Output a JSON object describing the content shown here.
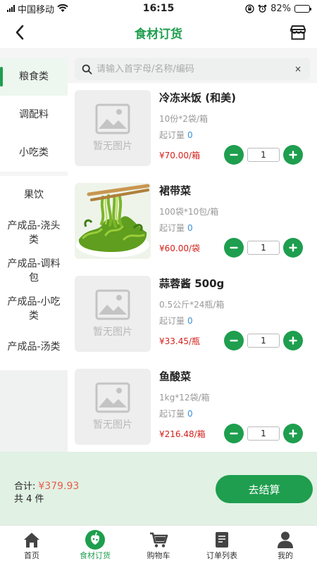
{
  "status_bar": {
    "carrier": "中国移动",
    "time": "16:15",
    "battery": "82%",
    "battery_level": 0.82
  },
  "header": {
    "title": "食材订货"
  },
  "search": {
    "placeholder": "请输入首字母/名称/编码",
    "clear": "×"
  },
  "categories": [
    {
      "label": "粮食类",
      "active": true
    },
    {
      "label": "调配料"
    },
    {
      "label": "小吃类"
    },
    {
      "label": "果饮"
    },
    {
      "label": "产成品-浇头类"
    },
    {
      "label": "产成品-调料包"
    },
    {
      "label": "产成品-小吃类"
    },
    {
      "label": "产成品-汤类"
    }
  ],
  "products": [
    {
      "name": "冷冻米饭 (和美)",
      "spec": "10份*2袋/箱",
      "moq_label": "起订量",
      "moq": "0",
      "price": "¥70.00/箱",
      "qty": "1",
      "image": "no-image",
      "no_image_text": "暂无图片"
    },
    {
      "name": "裙带菜",
      "spec": "100袋*10包/箱",
      "moq_label": "起订量",
      "moq": "0",
      "price": "¥60.00/袋",
      "qty": "1",
      "image": "seaweed-photo"
    },
    {
      "name": "蒜蓉酱 500g",
      "spec": "0.5公斤*24瓶/箱",
      "moq_label": "起订量",
      "moq": "0",
      "price": "¥33.45/瓶",
      "qty": "1",
      "image": "no-image",
      "no_image_text": "暂无图片"
    },
    {
      "name": "鱼酸菜",
      "spec": "1kg*12袋/箱",
      "moq_label": "起订量",
      "moq": "0",
      "price": "¥216.48/箱",
      "qty": "1",
      "image": "no-image",
      "no_image_text": "暂无图片"
    }
  ],
  "checkout": {
    "total_label": "合计:",
    "total_amount": "¥379.93",
    "count_text": "共 4 件",
    "pay_label": "去结算"
  },
  "tabbar": [
    {
      "label": "首页",
      "icon": "home-icon"
    },
    {
      "label": "食材订货",
      "icon": "food-order-icon",
      "active": true
    },
    {
      "label": "购物车",
      "icon": "cart-icon"
    },
    {
      "label": "订单列表",
      "icon": "order-list-icon"
    },
    {
      "label": "我的",
      "icon": "user-icon"
    }
  ],
  "colors": {
    "accent": "#1e9e4e",
    "price": "#d2211b",
    "total": "#e85d4a",
    "checkout_bg": "#e1f1e4"
  }
}
